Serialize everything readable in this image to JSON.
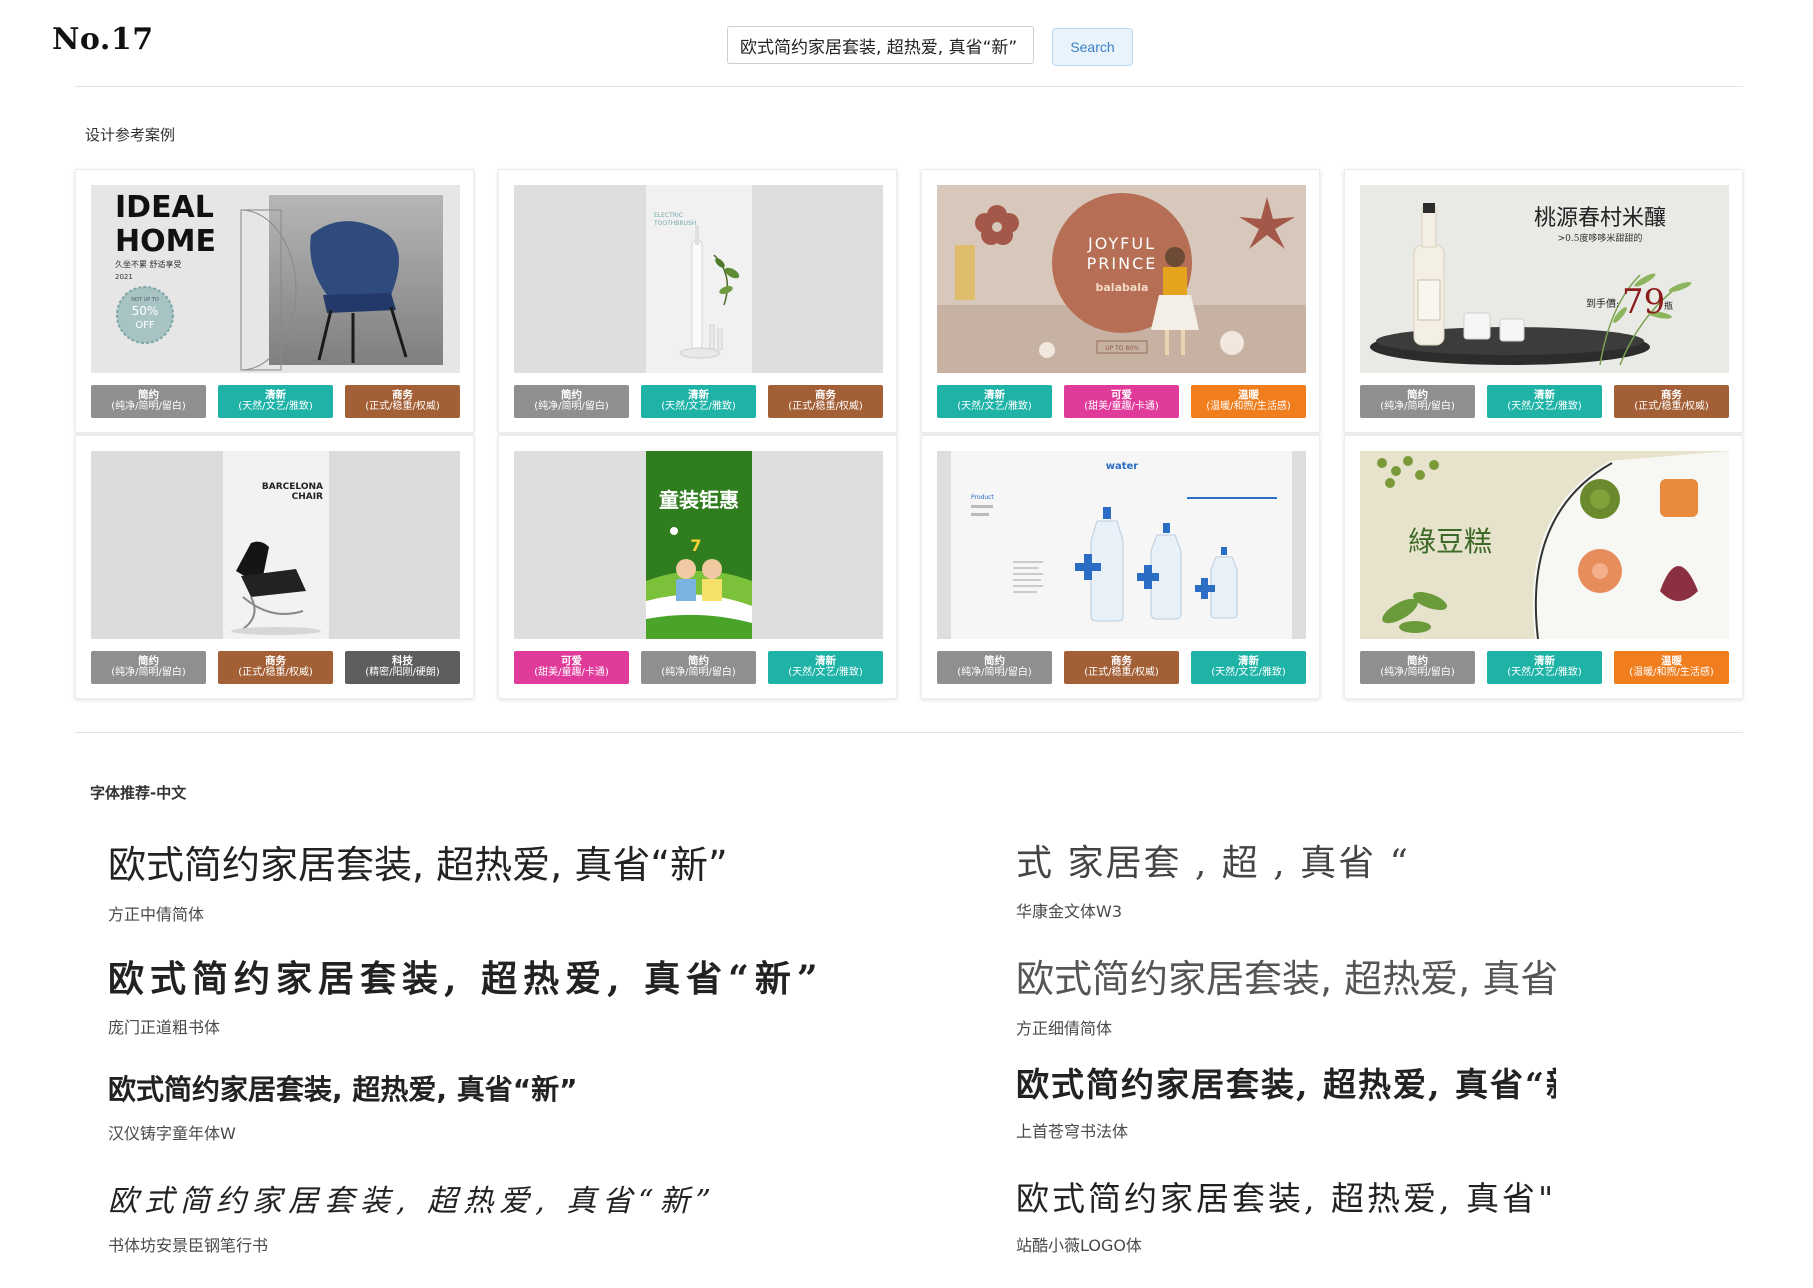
{
  "header": {
    "page_number": "No.17",
    "search_value": "欧式简约家居套装, 超热爱, 真省“新”",
    "search_button": "Search"
  },
  "section_cases": {
    "title": "设计参考案例",
    "cards": [
      {
        "image": "ideal-home-chair",
        "image_text": [
          "IDEAL",
          "HOME",
          "久坐不累 舒适享受",
          "2021",
          "NOT UP TO",
          "50%",
          "OFF"
        ],
        "tags": [
          {
            "name": "简约",
            "desc": "(纯净/简明/留白)",
            "color": "#8f8f8f"
          },
          {
            "name": "清新",
            "desc": "(天然/文艺/雅致)",
            "color": "#1fb3a8"
          },
          {
            "name": "商务",
            "desc": "(正式/稳重/权威)",
            "color": "#a35f35"
          }
        ]
      },
      {
        "image": "electric-toothbrush",
        "image_text": [
          "ELECTRIC",
          "TOOTHBRUSH"
        ],
        "tags": [
          {
            "name": "简约",
            "desc": "(纯净/简明/留白)",
            "color": "#8f8f8f"
          },
          {
            "name": "清新",
            "desc": "(天然/文艺/雅致)",
            "color": "#1fb3a8"
          },
          {
            "name": "商务",
            "desc": "(正式/稳重/权威)",
            "color": "#a35f35"
          }
        ]
      },
      {
        "image": "joyful-prince-kids",
        "image_text": [
          "JOYFUL",
          "PRINCE",
          "balabala",
          "UP TO 80%"
        ],
        "tags": [
          {
            "name": "清新",
            "desc": "(天然/文艺/雅致)",
            "color": "#1fb3a8"
          },
          {
            "name": "可爱",
            "desc": "(甜美/童趣/卡通)",
            "color": "#e03a9a"
          },
          {
            "name": "温暖",
            "desc": "(温暖/和煦/生活感)",
            "color": "#f07d1e"
          }
        ]
      },
      {
        "image": "rice-wine-bottle",
        "image_text": [
          "桃源春村米釀",
          ">0.5度哆哆米甜甜的",
          "到手價:",
          "79",
          "瓶"
        ],
        "tags": [
          {
            "name": "简约",
            "desc": "(纯净/简明/留白)",
            "color": "#8f8f8f"
          },
          {
            "name": "清新",
            "desc": "(天然/文艺/雅致)",
            "color": "#1fb3a8"
          },
          {
            "name": "商务",
            "desc": "(正式/稳重/权威)",
            "color": "#a35f35"
          }
        ]
      },
      {
        "image": "barcelona-chair",
        "image_text": [
          "BARCELONA",
          "CHAIR"
        ],
        "tags": [
          {
            "name": "简约",
            "desc": "(纯净/简明/留白)",
            "color": "#8f8f8f"
          },
          {
            "name": "商务",
            "desc": "(正式/稳重/权威)",
            "color": "#a35f35"
          },
          {
            "name": "科技",
            "desc": "(精密/阳刚/硬朗)",
            "color": "#5e5e5e"
          }
        ]
      },
      {
        "image": "kids-clothing-sale",
        "image_text": [
          "童装钜惠",
          "7"
        ],
        "tags": [
          {
            "name": "可爱",
            "desc": "(甜美/童趣/卡通)",
            "color": "#e03a9a"
          },
          {
            "name": "简约",
            "desc": "(纯净/简明/留白)",
            "color": "#8f8f8f"
          },
          {
            "name": "清新",
            "desc": "(天然/文艺/雅致)",
            "color": "#1fb3a8"
          }
        ]
      },
      {
        "image": "water-bottles",
        "image_text": [
          "water",
          "Product"
        ],
        "tags": [
          {
            "name": "简约",
            "desc": "(纯净/简明/留白)",
            "color": "#8f8f8f"
          },
          {
            "name": "商务",
            "desc": "(正式/稳重/权威)",
            "color": "#a35f35"
          },
          {
            "name": "清新",
            "desc": "(天然/文艺/雅致)",
            "color": "#1fb3a8"
          }
        ]
      },
      {
        "image": "mung-bean-cake",
        "image_text": [
          "綠豆糕"
        ],
        "tags": [
          {
            "name": "简约",
            "desc": "(纯净/简明/留白)",
            "color": "#8f8f8f"
          },
          {
            "name": "清新",
            "desc": "(天然/文艺/雅致)",
            "color": "#1fb3a8"
          },
          {
            "name": "温暖",
            "desc": "(温暖/和煦/生活感)",
            "color": "#f07d1e"
          }
        ]
      }
    ]
  },
  "section_fonts": {
    "title": "字体推荐-中文",
    "samples": [
      {
        "text": "欧式简约家居套装, 超热爱, 真省“新”",
        "font_name": "方正中倩简体"
      },
      {
        "text": "式    家居套  , 超    , 真省  “",
        "font_name": "华康金文体W3"
      },
      {
        "text": "欧式简约家居套装, 超热爱, 真省“新”",
        "font_name": "庞门正道粗书体"
      },
      {
        "text": "欧式简约家居套装, 超热爱, 真省 “",
        "font_name": "方正细倩简体"
      },
      {
        "text": "欧式简约家居套装, 超热爱, 真省“新”",
        "font_name": "汉仪铸字童年体W"
      },
      {
        "text": "欧式简约家居套装, 超热爱, 真省“新”",
        "font_name": "上首苍穹书法体"
      },
      {
        "text": "欧式简约家居套装, 超热爱, 真省“新”",
        "font_name": "书体坊安景臣钢笔行书"
      },
      {
        "text": "欧式简约家居套装, 超热爱, 真省\"新",
        "font_name": "站酷小薇LOGO体"
      }
    ]
  }
}
